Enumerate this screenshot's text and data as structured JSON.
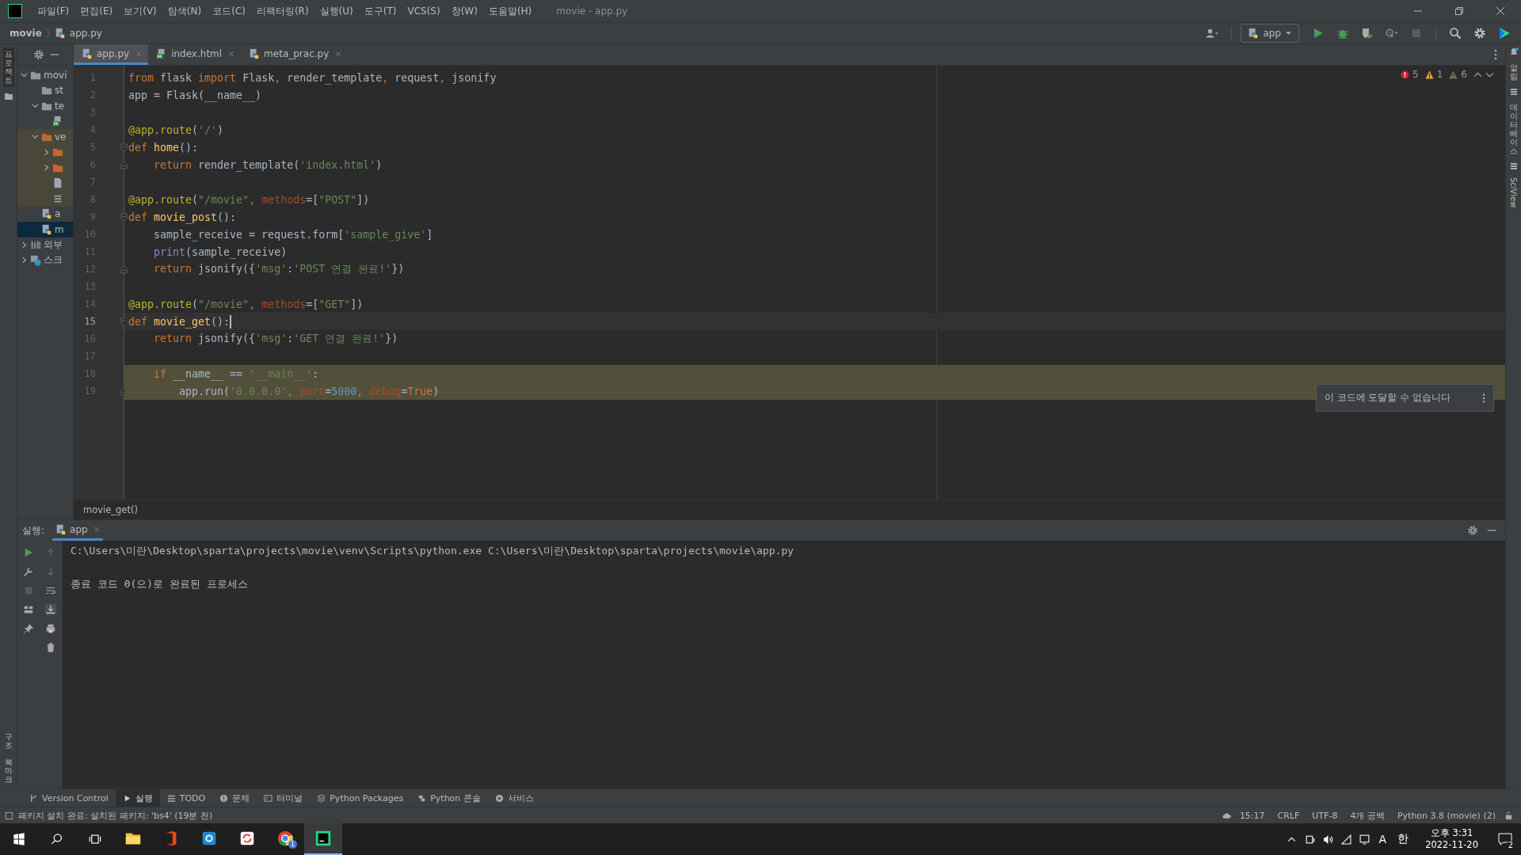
{
  "window": {
    "title": "movie - app.py"
  },
  "menu": [
    "파일(F)",
    "편집(E)",
    "보기(V)",
    "탐색(N)",
    "코드(C)",
    "리팩터링(R)",
    "실행(U)",
    "도구(T)",
    "VCS(S)",
    "창(W)",
    "도움말(H)"
  ],
  "breadcrumb": [
    "movie",
    "app.py"
  ],
  "run_config": "app",
  "left_stripe_top": [
    "프로젝트"
  ],
  "left_stripe_bottom": [
    "구조",
    "북마크"
  ],
  "right_stripe": [
    {
      "label": "알림",
      "kind": "stacked"
    },
    {
      "label": "데이터베이스",
      "kind": "stacked"
    },
    {
      "label": "SciView",
      "kind": "rotated"
    }
  ],
  "project_tree": [
    {
      "label": "movi",
      "kind": "folder",
      "expanded": true,
      "selected": false,
      "children": [
        {
          "label": "st",
          "kind": "folder",
          "selected": false,
          "excluded": false
        },
        {
          "label": "te",
          "kind": "folder",
          "expanded": true,
          "selected": false,
          "excluded": false,
          "children": [
            {
              "kind": "html",
              "selected": false
            }
          ]
        },
        {
          "label": "ve",
          "kind": "venv",
          "expanded": true,
          "selected": false,
          "excluded": true,
          "children": [
            {
              "kind": "venv",
              "expanded": false,
              "selected": false
            },
            {
              "kind": "venv",
              "expanded": false,
              "selected": false
            },
            {
              "kind": "file",
              "selected": false
            },
            {
              "kind": "text",
              "selected": false
            }
          ]
        },
        {
          "label": "a",
          "kind": "python",
          "selected": false,
          "excluded": false
        },
        {
          "label": "m",
          "kind": "python",
          "selected": true,
          "excluded": false
        }
      ]
    },
    {
      "label": "외부",
      "kind": "library",
      "expanded": false,
      "selected": false
    },
    {
      "label": "스크",
      "kind": "scratch",
      "expanded": false,
      "selected": false
    }
  ],
  "editor_tabs": [
    {
      "label": "app.py",
      "kind": "python",
      "selected": true
    },
    {
      "label": "index.html",
      "kind": "html",
      "selected": false
    },
    {
      "label": "meta_prac.py",
      "kind": "python",
      "selected": false
    }
  ],
  "inspections": {
    "errors": "5",
    "warnings": "1",
    "weak_warnings": "6"
  },
  "code_lines": [
    {
      "number": "1",
      "current": false,
      "highlighted": false,
      "tokens": [
        {
          "kind": "keyword",
          "text": "from "
        },
        {
          "kind": "plain",
          "text": "flask "
        },
        {
          "kind": "keyword",
          "text": "import "
        },
        {
          "kind": "plain",
          "text": "Flask"
        },
        {
          "kind": "keyword",
          "text": ", "
        },
        {
          "kind": "plain",
          "text": "render_template"
        },
        {
          "kind": "keyword",
          "text": ", "
        },
        {
          "kind": "plain",
          "text": "request"
        },
        {
          "kind": "keyword",
          "text": ", "
        },
        {
          "kind": "plain",
          "text": "jsonify"
        }
      ]
    },
    {
      "number": "2",
      "current": false,
      "highlighted": false,
      "tokens": [
        {
          "kind": "plain",
          "text": "app = Flask(__name__)"
        }
      ]
    },
    {
      "number": "3",
      "current": false,
      "highlighted": false
    },
    {
      "number": "4",
      "current": false,
      "highlighted": false,
      "tokens": [
        {
          "kind": "decorator",
          "text": "@app.route"
        },
        {
          "kind": "plain",
          "text": "("
        },
        {
          "kind": "string",
          "text": "'/'"
        },
        {
          "kind": "plain",
          "text": ")"
        }
      ]
    },
    {
      "number": "5",
      "current": false,
      "highlighted": false,
      "fold_start": true,
      "tokens": [
        {
          "kind": "keyword",
          "text": "def "
        },
        {
          "kind": "function",
          "text": "home"
        },
        {
          "kind": "plain",
          "text": "():"
        }
      ]
    },
    {
      "number": "6",
      "current": false,
      "highlighted": false,
      "fold_end": true,
      "tokens": [
        {
          "kind": "keyword",
          "text": "    return "
        },
        {
          "kind": "plain",
          "text": "render_template("
        },
        {
          "kind": "string",
          "text": "'index.html'"
        },
        {
          "kind": "plain",
          "text": ")"
        }
      ]
    },
    {
      "number": "7",
      "current": false,
      "highlighted": false
    },
    {
      "number": "8",
      "current": false,
      "highlighted": false,
      "tokens": [
        {
          "kind": "decorator",
          "text": "@app.route"
        },
        {
          "kind": "plain",
          "text": "("
        },
        {
          "kind": "string",
          "text": "\"/movie\""
        },
        {
          "kind": "keyword",
          "text": ", "
        },
        {
          "kind": "parameter",
          "text": "methods"
        },
        {
          "kind": "plain",
          "text": "=["
        },
        {
          "kind": "string",
          "text": "\"POST\""
        },
        {
          "kind": "plain",
          "text": "])"
        }
      ]
    },
    {
      "number": "9",
      "current": false,
      "highlighted": false,
      "fold_start": true,
      "tokens": [
        {
          "kind": "keyword",
          "text": "def "
        },
        {
          "kind": "function",
          "text": "movie_post"
        },
        {
          "kind": "plain",
          "text": "():"
        }
      ]
    },
    {
      "number": "10",
      "current": false,
      "highlighted": false,
      "tokens": [
        {
          "kind": "plain",
          "text": "    sample_receive = request.form["
        },
        {
          "kind": "string",
          "text": "'sample_give'"
        },
        {
          "kind": "plain",
          "text": "]"
        }
      ]
    },
    {
      "number": "11",
      "current": false,
      "highlighted": false,
      "tokens": [
        {
          "kind": "builtin",
          "text": "    print"
        },
        {
          "kind": "plain",
          "text": "(sample_receive)"
        }
      ]
    },
    {
      "number": "12",
      "current": false,
      "highlighted": false,
      "fold_end": true,
      "tokens": [
        {
          "kind": "keyword",
          "text": "    return "
        },
        {
          "kind": "plain",
          "text": "jsonify({"
        },
        {
          "kind": "string",
          "text": "'msg'"
        },
        {
          "kind": "plain",
          "text": ":"
        },
        {
          "kind": "string",
          "text": "'POST 연결 완료!'"
        },
        {
          "kind": "plain",
          "text": "})"
        }
      ]
    },
    {
      "number": "13",
      "current": false,
      "highlighted": false
    },
    {
      "number": "14",
      "current": false,
      "highlighted": false,
      "tokens": [
        {
          "kind": "decorator",
          "text": "@app.route"
        },
        {
          "kind": "plain",
          "text": "("
        },
        {
          "kind": "string",
          "text": "\"/movie\""
        },
        {
          "kind": "keyword",
          "text": ", "
        },
        {
          "kind": "parameter",
          "text": "methods"
        },
        {
          "kind": "plain",
          "text": "=["
        },
        {
          "kind": "string",
          "text": "\"GET\""
        },
        {
          "kind": "plain",
          "text": "])"
        }
      ]
    },
    {
      "number": "15",
      "current": true,
      "highlighted": false,
      "fold_start": true,
      "tokens": [
        {
          "kind": "keyword",
          "text": "def "
        },
        {
          "kind": "function",
          "text": "movie_get"
        },
        {
          "kind": "plain",
          "text": "():"
        }
      ]
    },
    {
      "number": "16",
      "current": false,
      "highlighted": false,
      "tokens": [
        {
          "kind": "keyword",
          "text": "    return "
        },
        {
          "kind": "plain",
          "text": "jsonify({"
        },
        {
          "kind": "string",
          "text": "'msg'"
        },
        {
          "kind": "plain",
          "text": ":"
        },
        {
          "kind": "string",
          "text": "'GET 연결 완료!'"
        },
        {
          "kind": "plain",
          "text": "})"
        }
      ]
    },
    {
      "number": "17",
      "current": false,
      "highlighted": false
    },
    {
      "number": "18",
      "current": false,
      "highlighted": true,
      "tokens": [
        {
          "kind": "keyword",
          "text": "    if "
        },
        {
          "kind": "plain",
          "text": "__name__ == "
        },
        {
          "kind": "string",
          "text": "'__main__'"
        },
        {
          "kind": "plain",
          "text": ":"
        }
      ]
    },
    {
      "number": "19",
      "current": false,
      "highlighted": true,
      "fold_end": true,
      "tokens": [
        {
          "kind": "plain",
          "text": "        app.run("
        },
        {
          "kind": "string",
          "text": "'0.0.0.0'"
        },
        {
          "kind": "keyword",
          "text": ", "
        },
        {
          "kind": "parameter",
          "text": "port"
        },
        {
          "kind": "plain",
          "text": "="
        },
        {
          "kind": "number",
          "text": "5000"
        },
        {
          "kind": "keyword",
          "text": ", "
        },
        {
          "kind": "parameter",
          "text": "debug"
        },
        {
          "kind": "plain",
          "text": "="
        },
        {
          "kind": "keyword",
          "text": "True"
        },
        {
          "kind": "plain",
          "text": ")"
        }
      ]
    }
  ],
  "code_breadcrumb": "movie_get()",
  "hint_popup": "이 코드에 도달할 수 없습니다",
  "run_panel": {
    "label": "실행:",
    "tab": "app",
    "output": [
      "C:\\Users\\미란\\Desktop\\sparta\\projects\\movie\\venv\\Scripts\\python.exe C:\\Users\\미란\\Desktop\\sparta\\projects\\movie\\app.py",
      "종료 코드 0(으)로 완료된 프로세스"
    ]
  },
  "tool_windows": [
    {
      "label": "Version Control",
      "kind": "branch",
      "selected": false
    },
    {
      "label": "실행",
      "kind": "play",
      "selected": true
    },
    {
      "label": "TODO",
      "kind": "list",
      "selected": false
    },
    {
      "label": "문제",
      "kind": "info",
      "selected": false
    },
    {
      "label": "터미널",
      "kind": "terminal",
      "selected": false
    },
    {
      "label": "Python Packages",
      "kind": "layers",
      "selected": false
    },
    {
      "label": "Python 콘솔",
      "kind": "python",
      "selected": false
    },
    {
      "label": "서비스",
      "kind": "services",
      "selected": false
    }
  ],
  "status_bar": {
    "message": "패키지 설치 완료: 설치된 패키지: 'bs4' (19분 전)",
    "items": [
      "15:17",
      "CRLF",
      "UTF-8",
      "4개 공백",
      "Python 3.8 (movie) (2)"
    ]
  },
  "taskbar": {
    "apps": [
      {
        "kind": "explorer",
        "active": false
      },
      {
        "kind": "office",
        "active": false
      },
      {
        "kind": "store",
        "active": false
      },
      {
        "kind": "sync",
        "active": false
      },
      {
        "kind": "chrome",
        "active": false,
        "badge": "1"
      },
      {
        "kind": "pycharm",
        "active": true
      }
    ],
    "tray_letters": [
      "A",
      "한"
    ],
    "time": "오후 3:31",
    "date": "2022-11-20",
    "notifications": "2"
  }
}
